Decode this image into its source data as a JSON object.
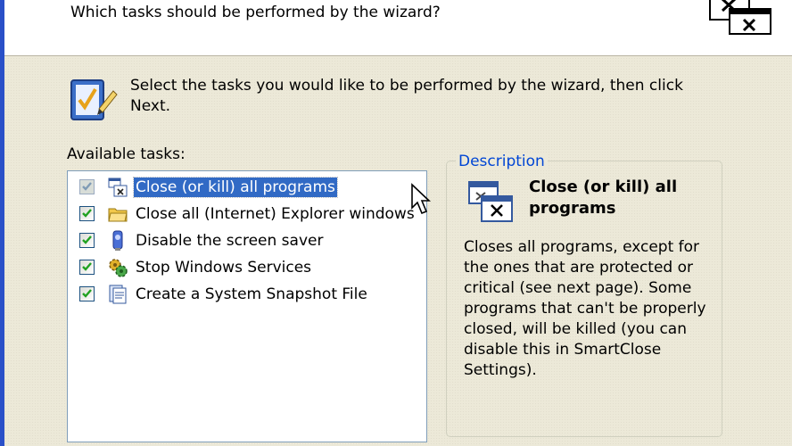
{
  "header": {
    "question": "Which tasks should be performed by the wizard?",
    "icon": "close-windows-icon"
  },
  "intro": {
    "icon": "checklist-pencil-icon",
    "text": "Select the tasks you would like to be performed by the wizard, then click Next."
  },
  "tasks_label": "Available tasks:",
  "tasks": [
    {
      "label": "Close (or kill) all programs",
      "checked": true,
      "selected": true,
      "icon": "close-programs-icon"
    },
    {
      "label": "Close all (Internet) Explorer windows",
      "checked": true,
      "selected": false,
      "icon": "folder-icon"
    },
    {
      "label": "Disable the screen saver",
      "checked": true,
      "selected": false,
      "icon": "screen-saver-icon"
    },
    {
      "label": "Stop Windows Services",
      "checked": true,
      "selected": false,
      "icon": "services-gear-icon"
    },
    {
      "label": "Create a System Snapshot File",
      "checked": true,
      "selected": false,
      "icon": "snapshot-file-icon"
    }
  ],
  "description": {
    "legend": "Description",
    "title": "Close (or kill) all programs",
    "icon": "close-programs-icon",
    "text": "Closes all programs, except for the ones that are protected or critical (see next page). Some programs that can't be properly closed, will be killed (you can disable this in SmartClose Settings)."
  },
  "colors": {
    "selection": "#316ac5",
    "legend": "#0046d5",
    "dialog_bg": "#ece9d8"
  }
}
